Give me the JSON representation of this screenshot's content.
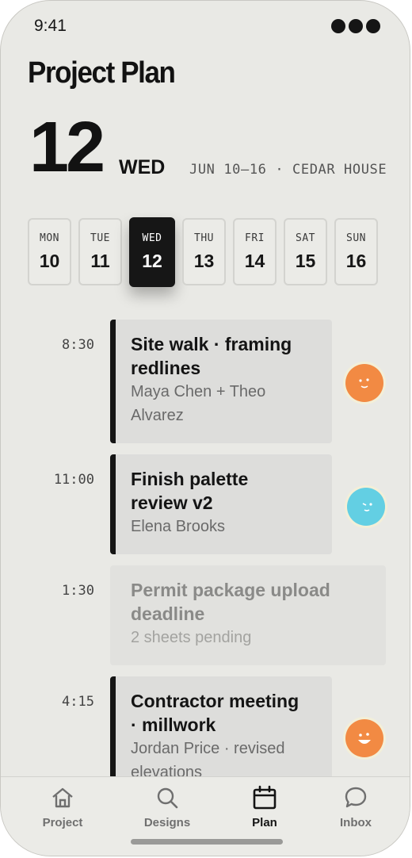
{
  "status": {
    "time": "9:41"
  },
  "header": {
    "title": "Project Plan",
    "day_number": "12",
    "day_of_week": "WED",
    "meta": "JUN 10–16 · CEDAR HOUSE"
  },
  "week": [
    {
      "dow": "MON",
      "date": "10"
    },
    {
      "dow": "TUE",
      "date": "11"
    },
    {
      "dow": "WED",
      "date": "12",
      "selected": true
    },
    {
      "dow": "THU",
      "date": "13"
    },
    {
      "dow": "FRI",
      "date": "14"
    },
    {
      "dow": "SAT",
      "date": "15"
    },
    {
      "dow": "SUN",
      "date": "16"
    }
  ],
  "events": [
    {
      "time": "8:30",
      "title_lines": [
        "Site walk · framing",
        "redlines"
      ],
      "subtitle_lines": [
        "Maya Chen + Theo",
        "Alvarez"
      ],
      "avatar_color": "#f28a43"
    },
    {
      "time": "11:00",
      "title_lines": [
        "Finish palette",
        "review v2"
      ],
      "subtitle_lines": [
        "Elena Brooks"
      ],
      "avatar_color": "#63cfe3"
    },
    {
      "time": "1:30",
      "title_lines": [
        "Permit package upload",
        "deadline"
      ],
      "subtitle_lines": [
        "2 sheets pending"
      ],
      "muted": true
    },
    {
      "time": "4:15",
      "title_lines": [
        "Contractor meeting",
        "· millwork"
      ],
      "subtitle_lines": [
        "Jordan Price · revised",
        "elevations"
      ],
      "avatar_color": "#f28a43"
    }
  ],
  "tabs": [
    {
      "label": "Project",
      "icon": "home-icon"
    },
    {
      "label": "Designs",
      "icon": "search-icon"
    },
    {
      "label": "Plan",
      "icon": "calendar-icon",
      "active": true
    },
    {
      "label": "Inbox",
      "icon": "chat-bubble-icon"
    }
  ],
  "colors": {
    "background": "#e9e9e5",
    "ink": "#151515",
    "accent_orange": "#f28a43",
    "accent_cyan": "#63cfe3"
  }
}
